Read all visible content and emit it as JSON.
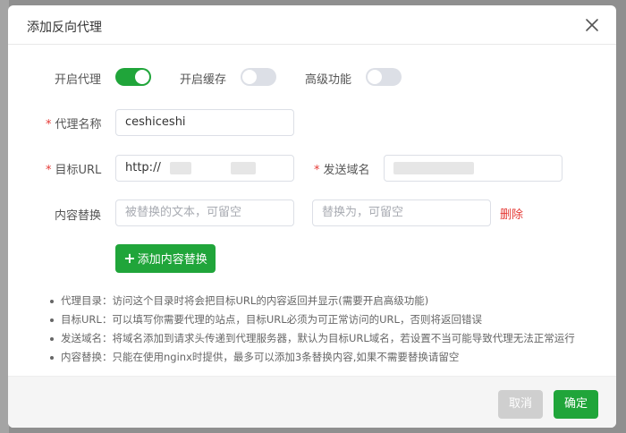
{
  "dialog": {
    "title": "添加反向代理",
    "close_icon": "close-icon"
  },
  "toggles": {
    "proxy": {
      "label": "开启代理",
      "on": true
    },
    "cache": {
      "label": "开启缓存",
      "on": false
    },
    "advanced": {
      "label": "高级功能",
      "on": false
    }
  },
  "form": {
    "proxy_name": {
      "label": "代理名称",
      "required": "*",
      "value": "ceshiceshi"
    },
    "target_url": {
      "label": "目标URL",
      "required": "*",
      "value": "http://"
    },
    "send_domain": {
      "label": "发送域名",
      "required": "*",
      "value": ""
    },
    "content_replace": {
      "label": "内容替换",
      "find_placeholder": "被替换的文本，可留空",
      "replace_placeholder": "替换为，可留空",
      "delete_label": "删除"
    },
    "add_replace_label": "添加内容替换"
  },
  "tips": [
    "代理目录：访问这个目录时将会把目标URL的内容返回并显示(需要开启高级功能)",
    "目标URL：可以填写你需要代理的站点，目标URL必须为可正常访问的URL，否则将返回错误",
    "发送域名：将域名添加到请求头传递到代理服务器，默认为目标URL域名，若设置不当可能导致代理无法正常运行",
    "内容替换：只能在使用nginx时提供，最多可以添加3条替换内容,如果不需要替换请留空"
  ],
  "footer": {
    "cancel_label": "取消",
    "ok_label": "确定"
  },
  "colors": {
    "accent": "#20a53a",
    "danger": "#e53935",
    "disabled": "#cfcfcf"
  }
}
